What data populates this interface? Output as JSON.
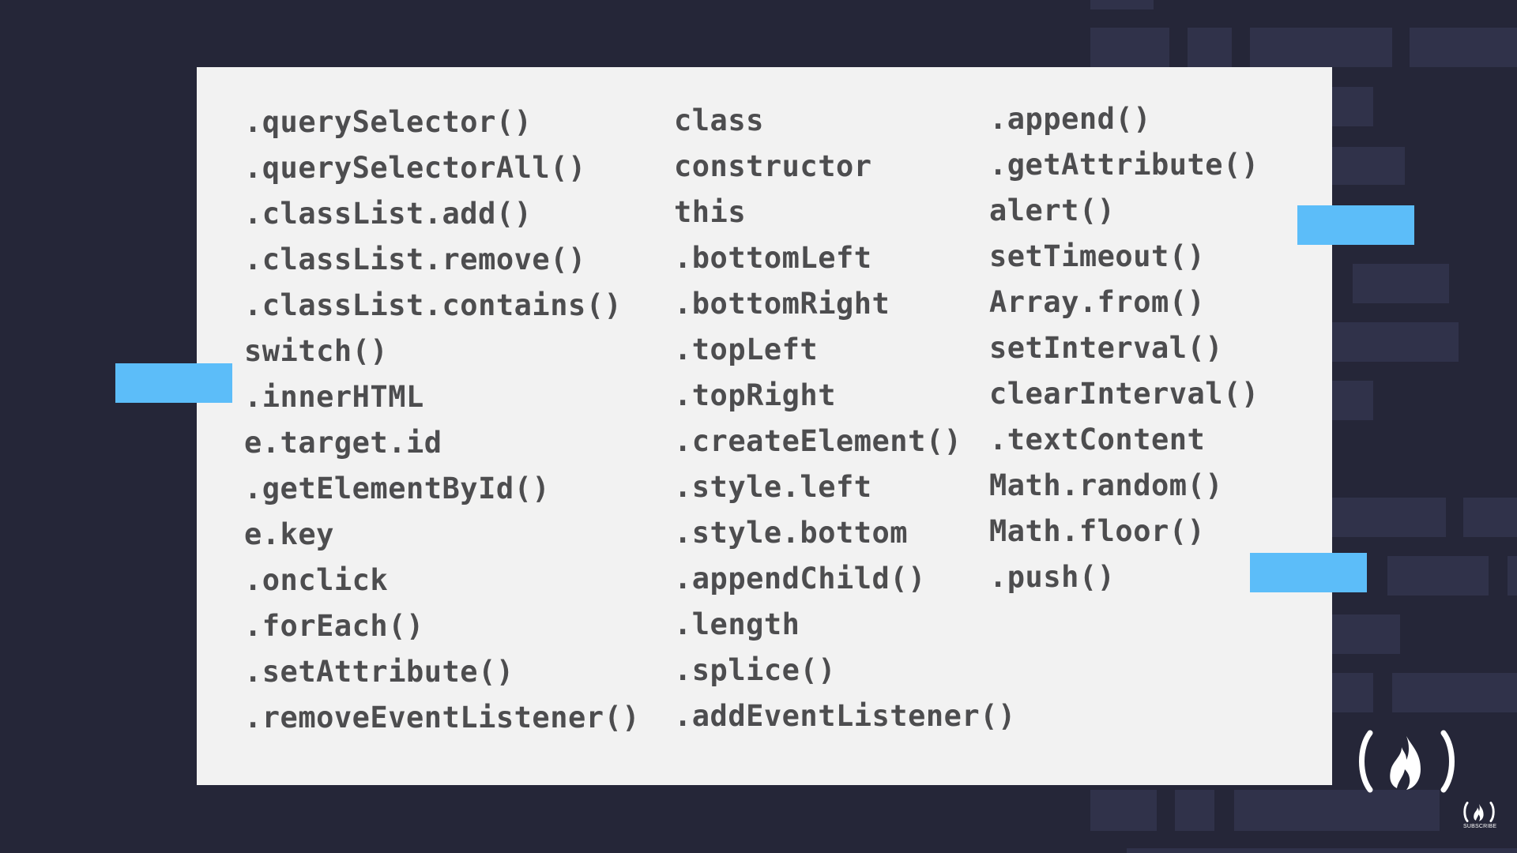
{
  "colors": {
    "background": "#252638",
    "card": "#f2f2f2",
    "text": "#4d4d4f",
    "accent": "#5cbdf9"
  },
  "columns": [
    [
      ".querySelector()",
      ".querySelectorAll()",
      ".classList.add()",
      ".classList.remove()",
      ".classList.contains()",
      "switch()",
      ".innerHTML",
      "e.target.id",
      ".getElementById()",
      "e.key",
      ".onclick",
      ".forEach()",
      ".setAttribute()",
      ".removeEventListener()"
    ],
    [
      "class",
      "constructor",
      "this",
      ".bottomLeft",
      ".bottomRight",
      ".topLeft",
      ".topRight",
      ".createElement()",
      ".style.left",
      ".style.bottom",
      ".appendChild()",
      ".length",
      ".splice()",
      ".addEventListener()"
    ],
    [
      ".append()",
      ".getAttribute()",
      "alert()",
      "setTimeout()",
      "Array.from()",
      "setInterval()",
      "clearInterval()",
      ".textContent",
      "Math.random()",
      "Math.floor()",
      ".push()"
    ]
  ],
  "logo": {
    "icon": "freecodecamp-flame-icon",
    "subscribe_label": "SUBSCRIBE"
  }
}
